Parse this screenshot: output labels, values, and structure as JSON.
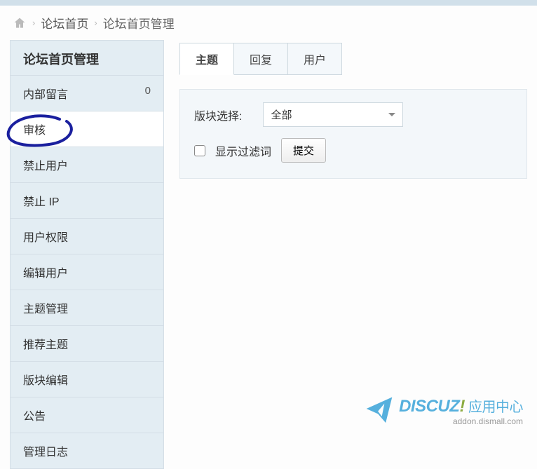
{
  "breadcrumb": {
    "item1": "论坛首页",
    "item2": "论坛首页管理"
  },
  "sidebar": {
    "title": "论坛首页管理",
    "items": [
      {
        "label": "内部留言",
        "badge": "0"
      },
      {
        "label": "审核"
      },
      {
        "label": "禁止用户"
      },
      {
        "label": "禁止 IP"
      },
      {
        "label": "用户权限"
      },
      {
        "label": "编辑用户"
      },
      {
        "label": "主题管理"
      },
      {
        "label": "推荐主题"
      },
      {
        "label": "版块编辑"
      },
      {
        "label": "公告"
      },
      {
        "label": "管理日志"
      }
    ],
    "active_index": 1
  },
  "tabs": {
    "items": [
      {
        "label": "主题"
      },
      {
        "label": "回复"
      },
      {
        "label": "用户"
      }
    ],
    "active_index": 0
  },
  "filter": {
    "forum_label": "版块选择:",
    "forum_selected": "全部",
    "show_filter_label": "显示过滤词",
    "submit_label": "提交"
  },
  "watermark": {
    "brand": "DISCUZ",
    "bang": "!",
    "cn": " 应用中心",
    "sub": "addon.dismall.com"
  },
  "annotation": {
    "purpose": "hand-drawn circle highlighting the 审核 sidebar item"
  }
}
